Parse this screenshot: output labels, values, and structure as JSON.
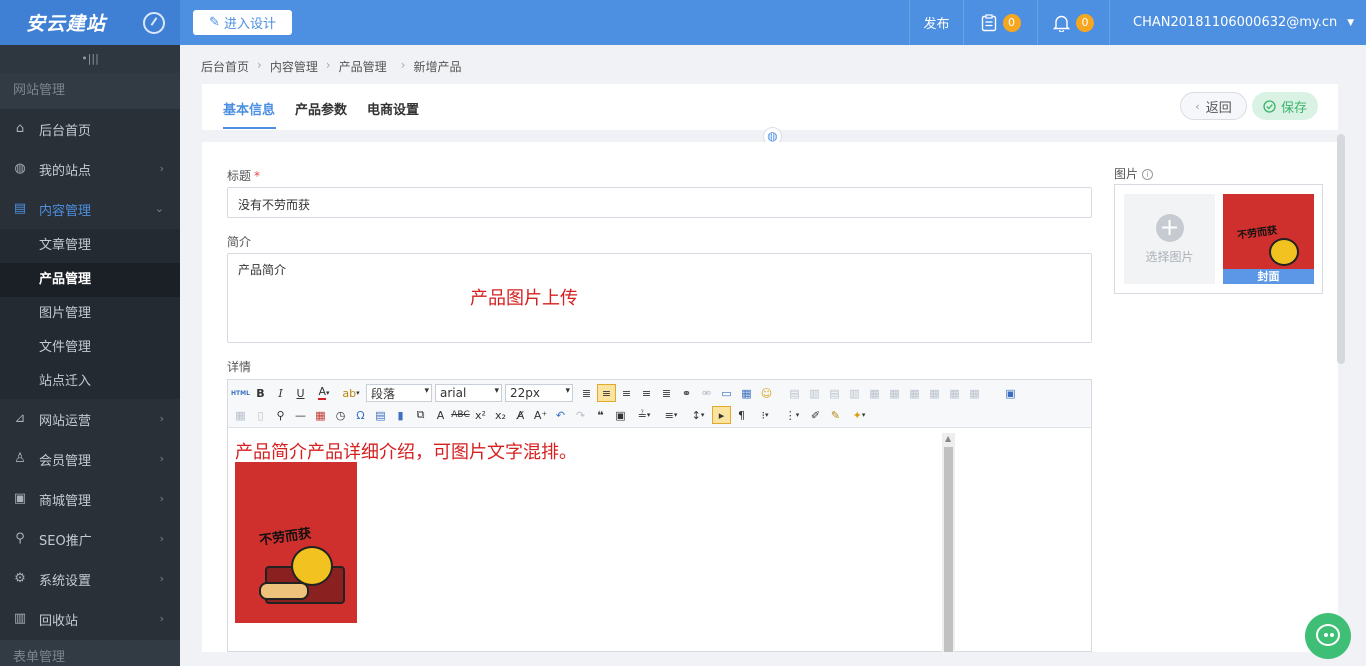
{
  "header": {
    "logo": "安云建站",
    "design_label": "进入设计",
    "publish": "发布",
    "task_count": "0",
    "notify_count": "0",
    "user": "CHAN20181106000632@my.cn"
  },
  "sidebar": {
    "section": "网站管理",
    "items": [
      {
        "label": "后台首页",
        "icon": "home-icon"
      },
      {
        "label": "我的站点",
        "icon": "globe-icon"
      },
      {
        "label": "内容管理",
        "icon": "document-icon"
      },
      {
        "label": "网站运营",
        "icon": "chart-icon"
      },
      {
        "label": "会员管理",
        "icon": "user-icon"
      },
      {
        "label": "商城管理",
        "icon": "shop-icon"
      },
      {
        "label": "SEO推广",
        "icon": "search-icon"
      },
      {
        "label": "系统设置",
        "icon": "gear-icon"
      },
      {
        "label": "回收站",
        "icon": "trash-icon"
      }
    ],
    "sub_items": [
      "文章管理",
      "产品管理",
      "图片管理",
      "文件管理",
      "站点迁入"
    ],
    "bottom_section": "表单管理"
  },
  "breadcrumb": [
    "后台首页",
    "内容管理",
    "产品管理",
    "新增产品"
  ],
  "tabs": [
    "基本信息",
    "产品参数",
    "电商设置"
  ],
  "actions": {
    "back": "返回",
    "save": "保存"
  },
  "form": {
    "title_label": "标题",
    "title_value": "没有不劳而获",
    "summary_label": "简介",
    "summary_value": "产品简介",
    "upload_note": "产品图片上传",
    "detail_label": "详情"
  },
  "editor": {
    "paragraph": "段落",
    "font": "arial",
    "size": "22px",
    "content": "产品简介产品详细介绍，可图片文字混排。",
    "poster_text": "不劳而获"
  },
  "picture": {
    "label": "图片",
    "select_label": "选择图片",
    "cover_label": "封面"
  },
  "colors": {
    "primary": "#4d8fe0",
    "sidebar": "#293038",
    "save": "#3bb46c",
    "red": "#d61f1f"
  }
}
